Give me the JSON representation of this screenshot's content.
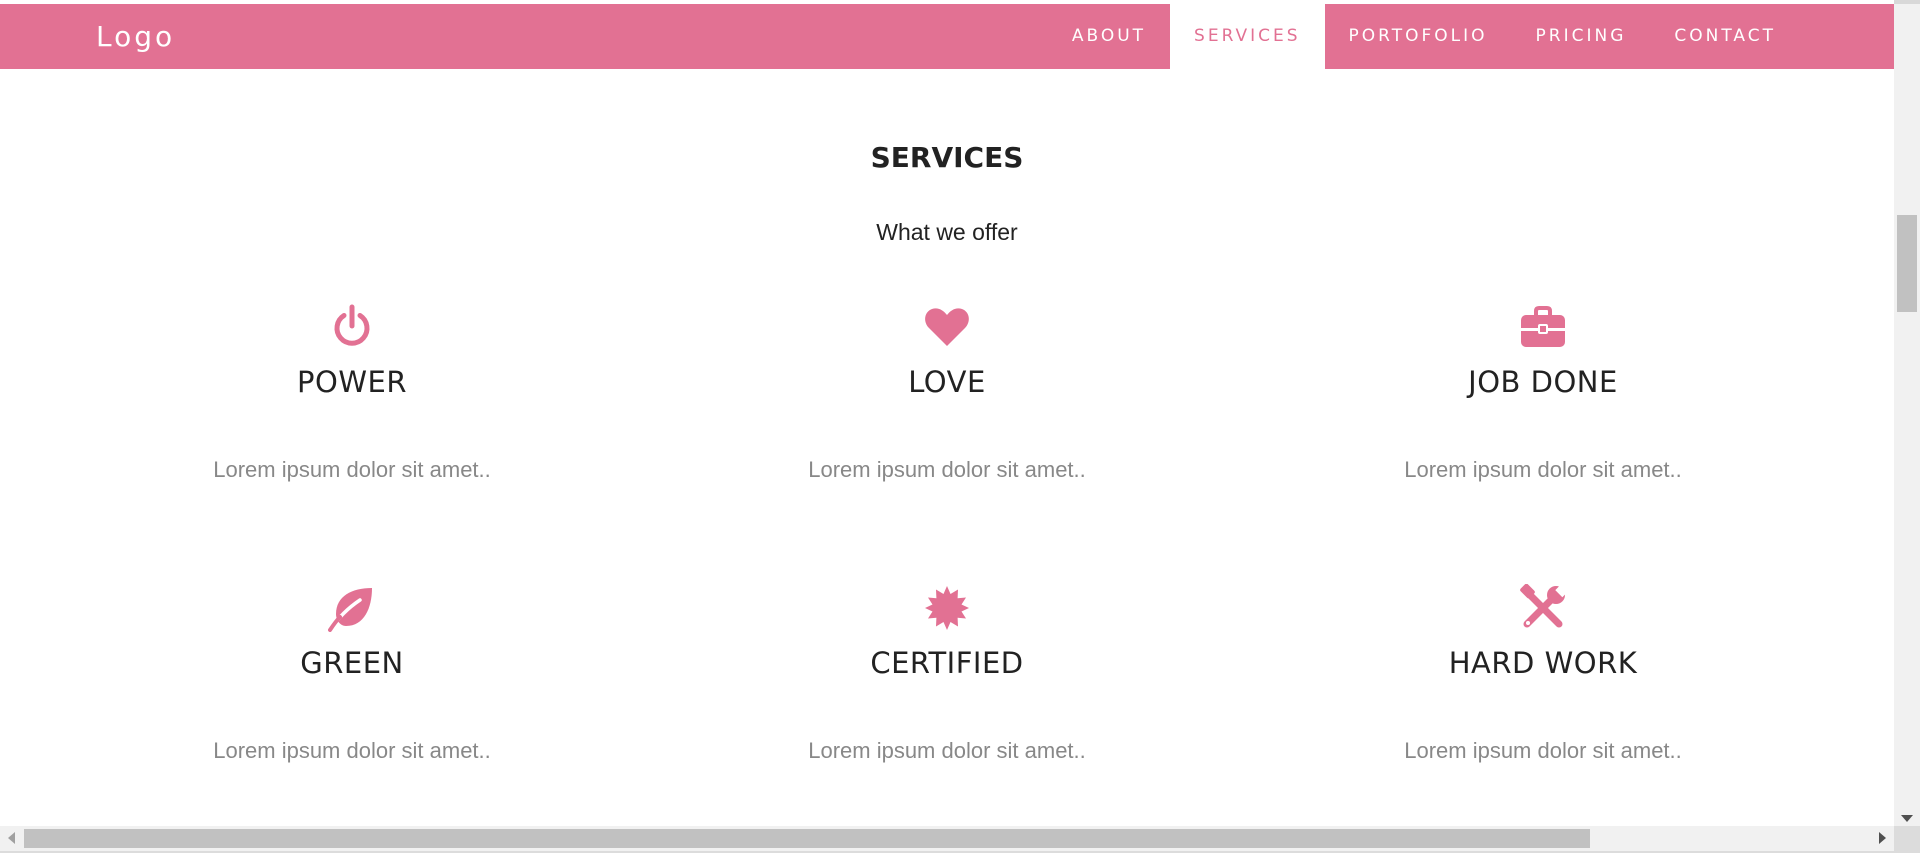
{
  "navbar": {
    "logo": "Logo",
    "background_color": "#e27193",
    "links": [
      {
        "label": "ABOUT",
        "active": false
      },
      {
        "label": "SERVICES",
        "active": true
      },
      {
        "label": "PORTOFOLIO",
        "active": false
      },
      {
        "label": "PRICING",
        "active": false
      },
      {
        "label": "CONTACT",
        "active": false
      }
    ]
  },
  "services": {
    "title": "SERVICES",
    "subtitle": "What we offer",
    "icon_color": "#e27193",
    "items": [
      {
        "icon": "power-icon",
        "title": "POWER",
        "text": "Lorem ipsum dolor sit amet.."
      },
      {
        "icon": "heart-icon",
        "title": "LOVE",
        "text": "Lorem ipsum dolor sit amet.."
      },
      {
        "icon": "briefcase-icon",
        "title": "JOB DONE",
        "text": "Lorem ipsum dolor sit amet.."
      },
      {
        "icon": "leaf-icon",
        "title": "GREEN",
        "text": "Lorem ipsum dolor sit amet.."
      },
      {
        "icon": "certificate-icon",
        "title": "CERTIFIED",
        "text": "Lorem ipsum dolor sit amet.."
      },
      {
        "icon": "wrench-icon",
        "title": "HARD WORK",
        "text": "Lorem ipsum dolor sit amet.."
      }
    ]
  }
}
